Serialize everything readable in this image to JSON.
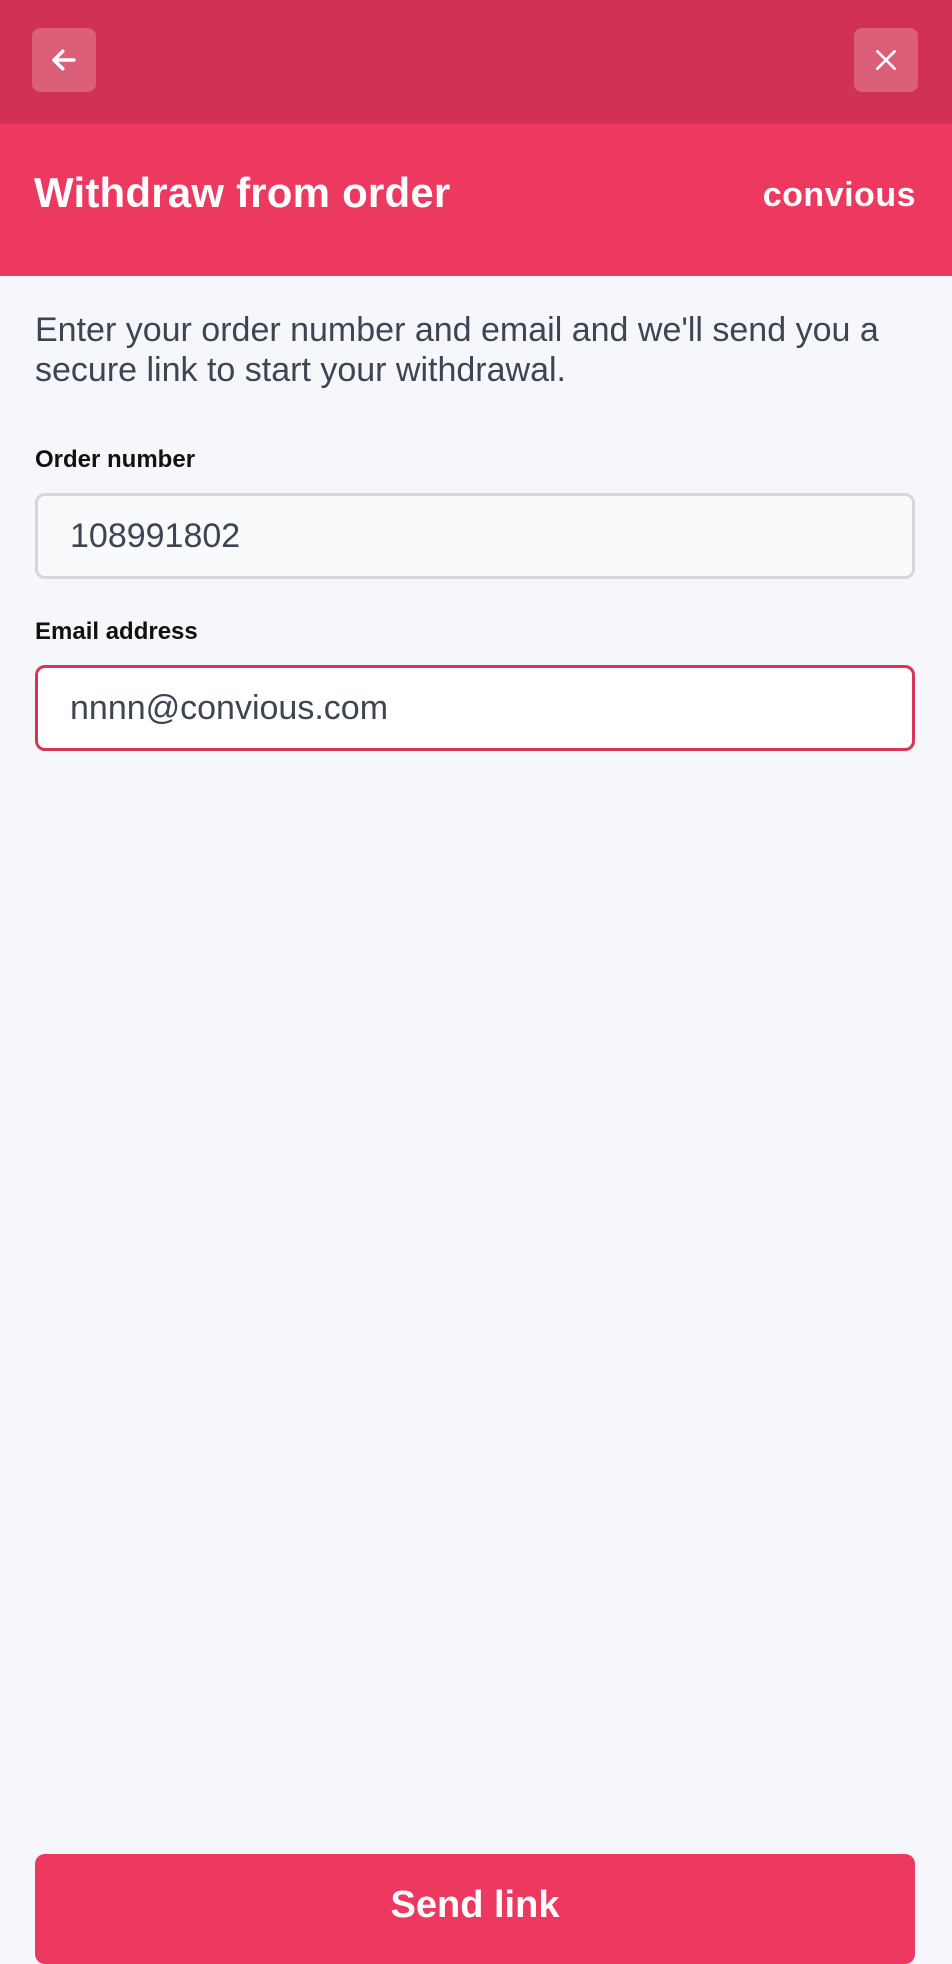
{
  "header": {
    "title": "Withdraw from order",
    "brand": "convious",
    "back_icon": "arrow-left-icon",
    "close_icon": "close-icon"
  },
  "intro_text": "Enter your order number and email and we'll send you a secure link to start your withdrawal.",
  "form": {
    "order_number": {
      "label": "Order number",
      "value": "108991802"
    },
    "email": {
      "label": "Email address",
      "value": "nnnn@convious.com"
    }
  },
  "actions": {
    "send_label": "Send link"
  },
  "colors": {
    "topbar": "#d13253",
    "header": "#ed3860",
    "background": "#f5f7fb",
    "text": "#3d4553",
    "focus_border": "#d73456"
  }
}
